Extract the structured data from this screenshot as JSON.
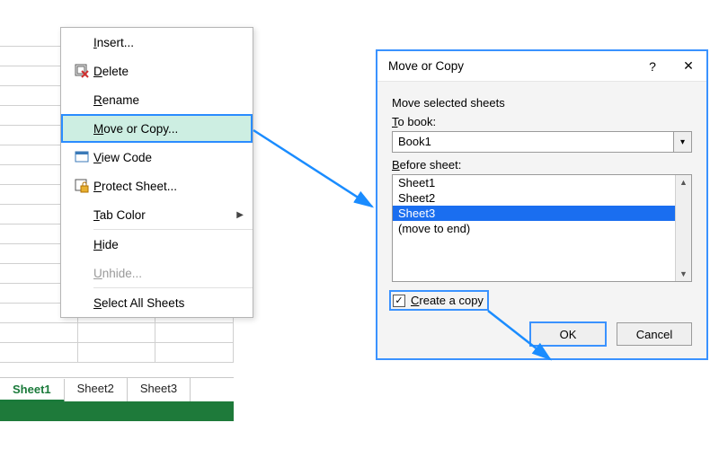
{
  "sheet_tabs": {
    "active": "Sheet1",
    "items": [
      {
        "label": "Sheet1"
      },
      {
        "label": "Sheet2"
      },
      {
        "label": "Sheet3"
      }
    ]
  },
  "context_menu": {
    "items": {
      "insert": {
        "label": "Insert...",
        "hotkey_index": 0
      },
      "delete": {
        "label": "Delete",
        "hotkey_index": 0
      },
      "rename": {
        "label": "Rename",
        "hotkey_index": 0
      },
      "move_or_copy": {
        "label": "Move or Copy...",
        "hotkey_index": 0
      },
      "view_code": {
        "label": "View Code",
        "hotkey_index": 0
      },
      "protect": {
        "label": "Protect Sheet...",
        "hotkey_index": 0
      },
      "tab_color": {
        "label": "Tab Color",
        "hotkey_index": 0
      },
      "hide": {
        "label": "Hide",
        "hotkey_index": 0
      },
      "unhide": {
        "label": "Unhide...",
        "hotkey_index": 0
      },
      "select_all": {
        "label": "Select All Sheets",
        "hotkey_index": 0
      }
    }
  },
  "dialog": {
    "title": "Move or Copy",
    "move_selected": "Move selected sheets",
    "to_book_label": "To book:",
    "to_book_value": "Book1",
    "before_sheet_label": "Before sheet:",
    "before_sheet_items": [
      "Sheet1",
      "Sheet2",
      "Sheet3",
      "(move to end)"
    ],
    "before_sheet_selected": "Sheet3",
    "create_copy_label": "Create a copy",
    "create_copy_checked": true,
    "buttons": {
      "ok": "OK",
      "cancel": "Cancel"
    },
    "help_glyph": "?",
    "close_glyph": "✕"
  }
}
